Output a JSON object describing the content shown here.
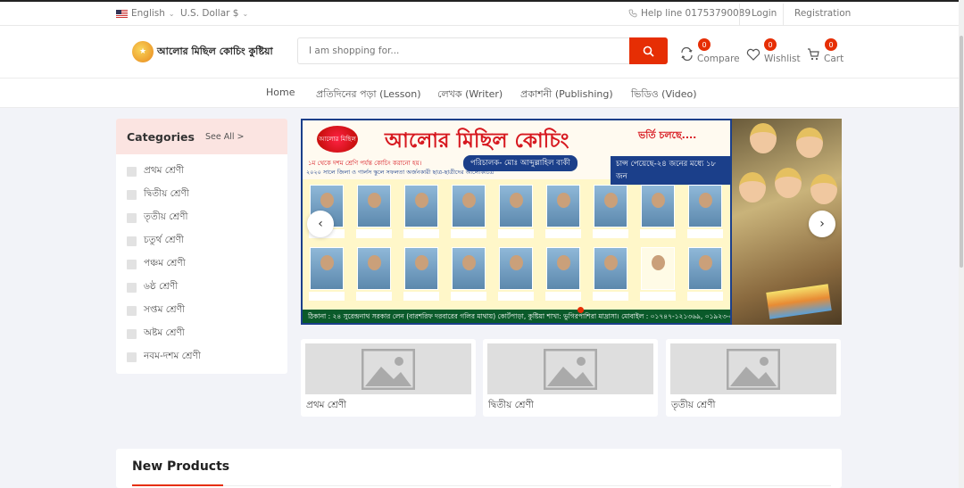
{
  "topbar": {
    "language": "English",
    "currency": "U.S. Dollar $",
    "helpline": "Help line 01753790089",
    "login": "Login",
    "registration": "Registration"
  },
  "header": {
    "logo_text": "আলোর মিছিল কোচিং কুষ্টিয়া",
    "search_placeholder": "I am shopping for...",
    "compare_label": "Compare",
    "compare_count": "0",
    "wishlist_label": "Wishlist",
    "wishlist_count": "0",
    "cart_label": "Cart",
    "cart_count": "0"
  },
  "nav": {
    "items": [
      {
        "label": "Home"
      },
      {
        "label": "প্রতিদিনের পড়া (Lesson)"
      },
      {
        "label": "লেখক (Writer)"
      },
      {
        "label": "প্রকাশনী (Publishing)"
      },
      {
        "label": "ভিডিও (Video)"
      }
    ]
  },
  "categories": {
    "title": "Categories",
    "see_all": "See All >",
    "items": [
      {
        "label": "প্রথম শ্রেণী"
      },
      {
        "label": "দ্বিতীয় শ্রেণী"
      },
      {
        "label": "তৃতীয় শ্রেণী"
      },
      {
        "label": "চতুর্থ শ্রেণী"
      },
      {
        "label": "পঞ্চম শ্রেণী"
      },
      {
        "label": "৬ষ্ঠ শ্রেণী"
      },
      {
        "label": "সপ্তম শ্রেণী"
      },
      {
        "label": "অষ্টম শ্রেণী"
      },
      {
        "label": "নবম-দশম শ্রেণী"
      }
    ]
  },
  "banner": {
    "title": "আলোর মিছিল কোচিং",
    "subtitle": "ভর্তি চলছে....",
    "director": "পরিচালক- মোঃ আব্দুল্লাহিল বাকী",
    "line1": "১ম থেকে দশম শ্রেণি পর্যন্ত কোচিং করানো হয়।",
    "line2": "২০২০ সালে জিলা ও গার্লস স্কুলে সফলতা অর্জনকারী ছাত্র-ছাত্রীদের আলোকচিত্র",
    "badge": "চান্স পেয়েছে-২৪ জনের মধ্যে ১৮ জন",
    "footer": "ঠিকানা : ২৪ সুরেন্দ্রনাথ সরকার লেন (বারশরিফ দরবারের গলির মাথায়) কোর্টপাড়া, কুষ্টিয়া শাখা: ভুগিরপাশিরা মাদ্রাসা। মোবাইল : ০১৭৪৭-১২১৩৬৯, ০১৯২৩-৬০৭২৮০",
    "stamp": "আলোর মিছিল"
  },
  "featured": {
    "items": [
      {
        "label": "প্রথম শ্রেণী"
      },
      {
        "label": "দ্বিতীয় শ্রেণী"
      },
      {
        "label": "তৃতীয় শ্রেণী"
      }
    ]
  },
  "sections": {
    "new_products": "New Products"
  },
  "colors": {
    "accent": "#e62e04",
    "category_header": "#fbe4e1",
    "page_bg": "#f2f3f8"
  }
}
